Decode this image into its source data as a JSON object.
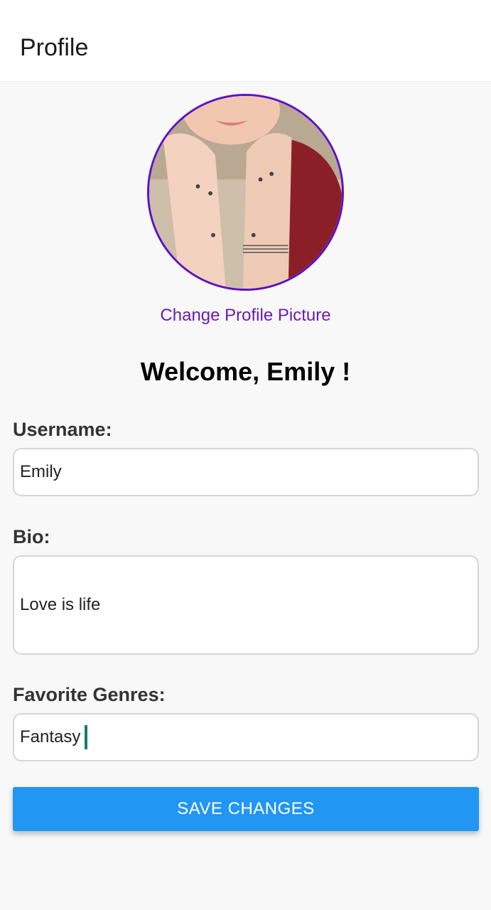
{
  "header": {
    "title": "Profile"
  },
  "profile": {
    "change_picture_label": "Change Profile Picture",
    "welcome_text": "Welcome, Emily !"
  },
  "form": {
    "username_label": "Username:",
    "username_value": "Emily",
    "bio_label": "Bio:",
    "bio_value": "Love is life",
    "genres_label": "Favorite Genres:",
    "genres_value": "Fantasy",
    "save_label": "SAVE CHANGES"
  },
  "colors": {
    "accent_purple": "#6a1bb3",
    "avatar_border": "#5b12c9",
    "button_blue": "#2196f3",
    "caret_teal": "#1a7a6e"
  },
  "icons": {
    "avatar": "profile-photo"
  }
}
